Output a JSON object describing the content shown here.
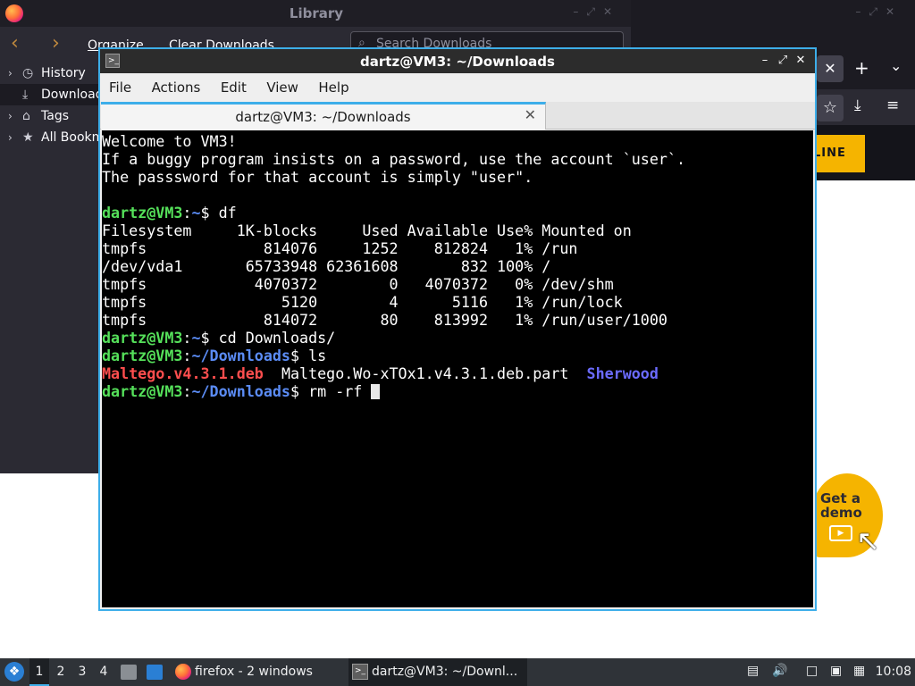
{
  "library": {
    "title": "Library",
    "toolbar": {
      "organize_label": "Organize",
      "clear_label": "Clear Downloads",
      "search_placeholder": "Search Downloads"
    },
    "sidebar": [
      {
        "label": "History",
        "icon": "clock-icon"
      },
      {
        "label": "Downloads",
        "icon": "download-icon"
      },
      {
        "label": "Tags",
        "icon": "tag-icon"
      },
      {
        "label": "All Bookmarks",
        "icon": "star-icon"
      }
    ]
  },
  "browser": {
    "cta_label": "LINE",
    "demo_label_line1": "Get a",
    "demo_label_line2": "demo"
  },
  "terminal": {
    "window_title": "dartz@VM3: ~/Downloads",
    "menu": [
      "File",
      "Actions",
      "Edit",
      "View",
      "Help"
    ],
    "tab_label": "dartz@VM3: ~/Downloads",
    "welcome_lines": [
      "Welcome to VM3!",
      "If a buggy program insists on a password, use the account `user`.",
      "The passsword for that account is simply \"user\"."
    ],
    "prompt_user": "dartz@VM3",
    "df_command": "df",
    "df_header": "Filesystem     1K-blocks     Used Available Use% Mounted on",
    "df_rows": [
      "tmpfs             814076     1252    812824   1% /run",
      "/dev/vda1       65733948 62361608       832 100% /",
      "tmpfs            4070372        0   4070372   0% /dev/shm",
      "tmpfs               5120        4      5116   1% /run/lock",
      "tmpfs             814072       80    813992   1% /run/user/1000"
    ],
    "home_path": "~",
    "downloads_path": "~/Downloads",
    "cd_command": "cd Downloads/",
    "ls_command": "ls",
    "ls_output": [
      "Maltego.v4.3.1.deb",
      "Maltego.Wo-xTOx1.v4.3.1.deb.part",
      "Sherwood"
    ],
    "current_input": "rm -rf "
  },
  "taskbar": {
    "workspaces": [
      "1",
      "2",
      "3",
      "4"
    ],
    "active_workspace": "1",
    "firefox_task": "firefox - 2 windows",
    "terminal_task": "dartz@VM3: ~/Downl...",
    "clock": "10:08"
  },
  "colors": {
    "accent": "#3daee9",
    "prompt_green": "#55e05a",
    "path_blue": "#5b8cf5",
    "deb_red": "#ff4e4e",
    "dir_blue": "#6b6bff",
    "cta_yellow": "#f5b400"
  }
}
